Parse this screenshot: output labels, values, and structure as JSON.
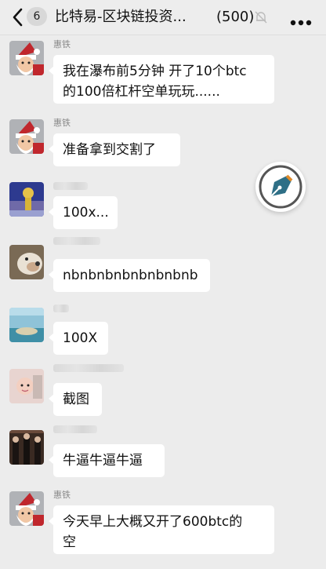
{
  "header": {
    "back_badge": "6",
    "title": "比特易-区块链投资...",
    "member_count": "(500)"
  },
  "messages": [
    {
      "sender": "惠铁",
      "text": "我在瀑布前5分钟 开了10个btc\n的100倍杠杆空单玩玩......"
    },
    {
      "sender": "惠铁",
      "text": "准备拿到交割了"
    },
    {
      "sender": "",
      "text": "100x..."
    },
    {
      "sender": "",
      "text": "nbnbnbnbnbnbnbnb"
    },
    {
      "sender": "",
      "text": "100X"
    },
    {
      "sender": "",
      "text": "截图"
    },
    {
      "sender": "",
      "text": "牛逼牛逼牛逼"
    },
    {
      "sender": "惠铁",
      "text": "今天早上大概又开了600btc的\n空"
    }
  ],
  "icons": {
    "back": "chevron-left-icon",
    "mute": "mute-bell-icon",
    "more": "more-dots-icon",
    "floating": "pen-nib-icon"
  },
  "colors": {
    "page_bg": "#ececec",
    "bubble_bg": "#ffffff",
    "santa_red": "#c0272d"
  }
}
